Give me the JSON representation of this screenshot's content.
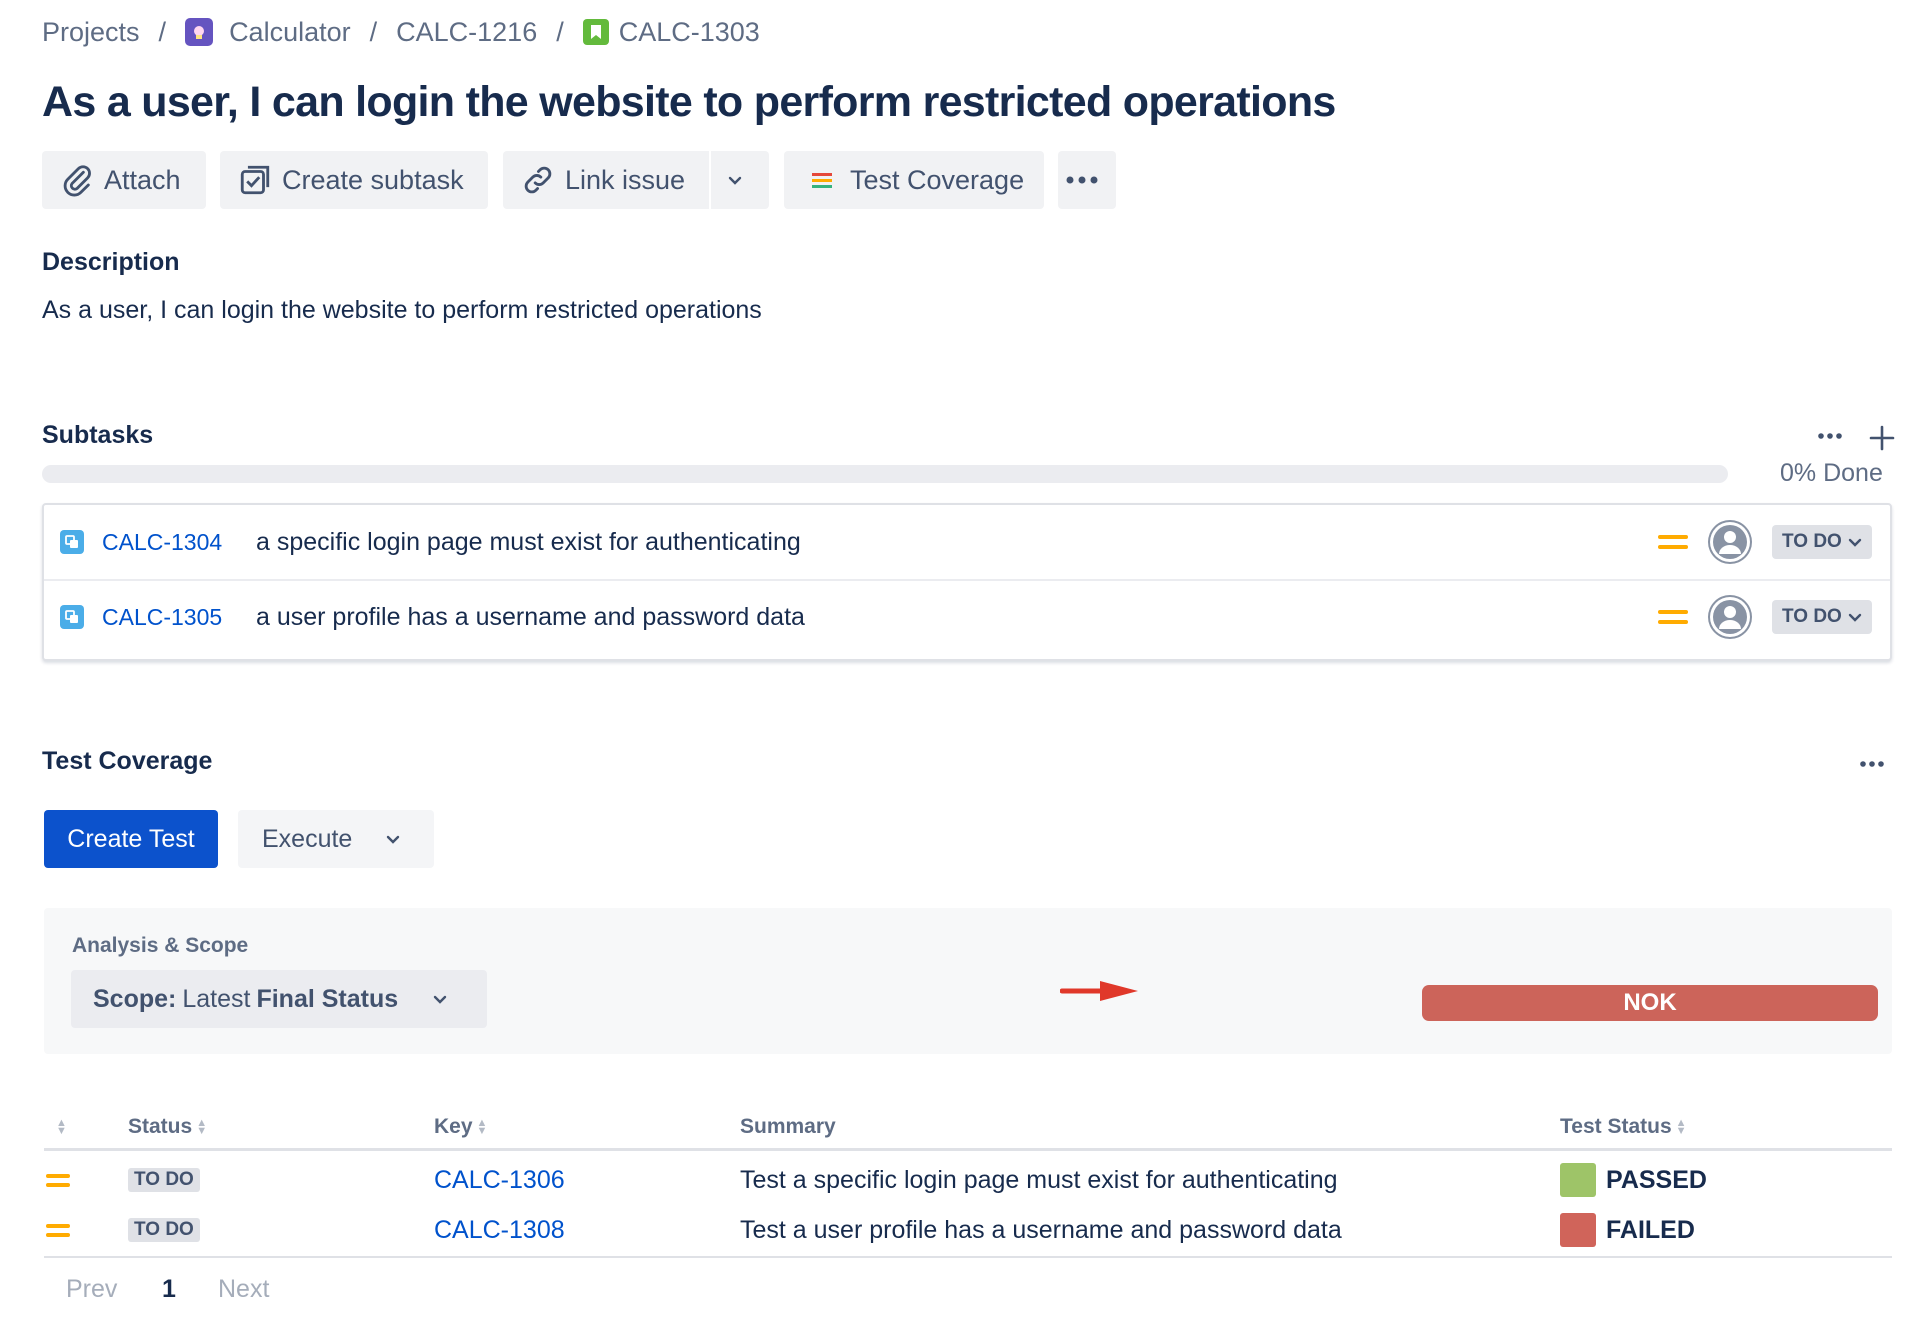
{
  "breadcrumb": {
    "projects": "Projects",
    "project": "Calculator",
    "parent": "CALC-1216",
    "issue": "CALC-1303",
    "separator": "/"
  },
  "issue": {
    "title": "As a user, I can login the website to perform restricted operations"
  },
  "toolbar": {
    "attach": "Attach",
    "create_subtask": "Create subtask",
    "link_issue": "Link issue",
    "test_coverage": "Test Coverage"
  },
  "description": {
    "heading": "Description",
    "text": "As a user, I can login the website to perform restricted operations"
  },
  "subtasks": {
    "heading": "Subtasks",
    "progress_percent": 0,
    "done_label": "0% Done",
    "items": [
      {
        "key": "CALC-1304",
        "summary": "a specific login page must exist for authenticating",
        "status": "TO DO"
      },
      {
        "key": "CALC-1305",
        "summary": "a user profile has a username and password data",
        "status": "TO DO"
      }
    ]
  },
  "test_coverage": {
    "heading": "Test Coverage",
    "create_test": "Create Test",
    "execute": "Execute",
    "analysis_label": "Analysis & Scope",
    "scope_label": "Scope:",
    "scope_value_light": "Latest",
    "scope_value_bold": "Final Status",
    "overall_status": "NOK",
    "columns": {
      "status": "Status",
      "key": "Key",
      "summary": "Summary",
      "test_status": "Test Status"
    },
    "rows": [
      {
        "status": "TO DO",
        "key": "CALC-1306",
        "summary": "Test a specific login page must exist for authenticating",
        "test_status": "PASSED",
        "test_color": "#9ec468"
      },
      {
        "status": "TO DO",
        "key": "CALC-1308",
        "summary": "Test a user profile has a username and password data",
        "test_status": "FAILED",
        "test_color": "#d0645a"
      }
    ],
    "pagination": {
      "prev": "Prev",
      "page": "1",
      "next": "Next"
    }
  },
  "colors": {
    "primary": "#0c52cc",
    "nok": "#cc645a",
    "link": "#0052cc",
    "priority": "#ffab00",
    "arrow": "#e0382a"
  },
  "icons": [
    "attach-icon",
    "create-subtask-icon",
    "link-icon",
    "chevron-down-icon",
    "test-coverage-icon",
    "more-icon",
    "plus-icon",
    "subtask-type-icon",
    "priority-medium-icon",
    "avatar-icon",
    "arrow-icon",
    "sort-icon"
  ]
}
